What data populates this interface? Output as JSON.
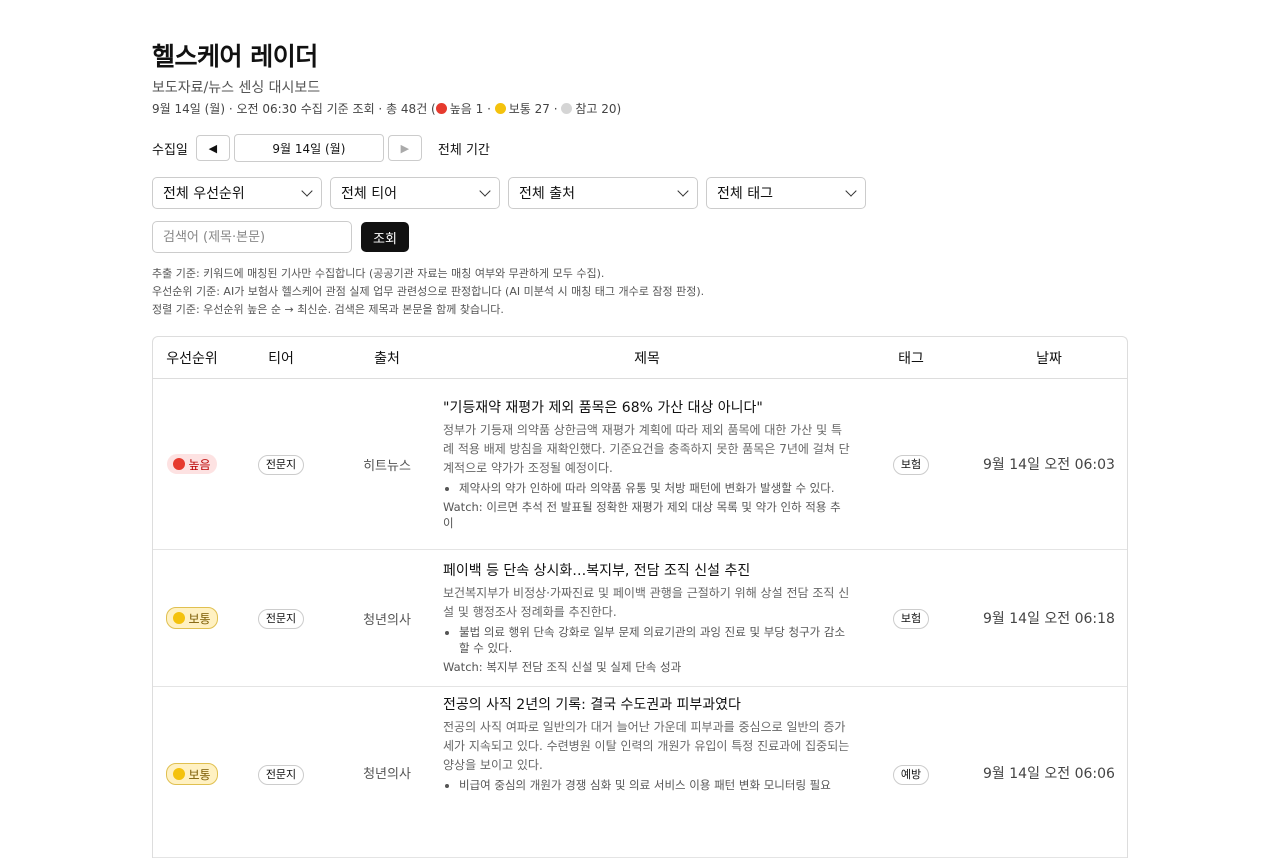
{
  "header": {
    "title": "헬스케어 레이더",
    "subtitle": "보도자료/뉴스 센싱 대시보드",
    "meta_prefix": "9월 14일 (월) · 오전 06:30 수집 기준 조회 · 총 48건 (",
    "meta_high": "높음 1",
    "meta_mid": "보통 27",
    "meta_ref": "참고 20)",
    "sep": " · "
  },
  "datebar": {
    "label": "수집일",
    "prev": "◀",
    "date": "9월 14일 (월)",
    "next": "▶",
    "all_period": "전체 기간"
  },
  "filters": [
    "전체 우선순위",
    "전체 티어",
    "전체 출처",
    "전체 태그"
  ],
  "search": {
    "placeholder": "검색어 (제목·본문)",
    "button": "조회"
  },
  "notes": [
    "추출 기준: 키워드에 매칭된 기사만 수집합니다 (공공기관 자료는 매칭 여부와 무관하게 모두 수집).",
    "우선순위 기준: AI가 보험사 헬스케어 관점 실제 업무 관련성으로 판정합니다 (AI 미분석 시 매칭 태그 개수로 잠정 판정).",
    "정렬 기준: 우선순위 높은 순 → 최신순. 검색은 제목과 본문을 함께 찾습니다."
  ],
  "table": {
    "headers": [
      "우선순위",
      "티어",
      "출처",
      "제목",
      "태그",
      "날짜"
    ],
    "rows": [
      {
        "priority": "높음",
        "priority_color": "#e63a2e",
        "tier": "전문지",
        "source": "히트뉴스",
        "title": "\"기등재약 재평가 제외 품목은 68% 가산 대상 아니다\"",
        "body": "정부가 기등재 의약품 상한금액 재평가 계획에 따라 제외 품목에 대한 가산 및 특례 적용 배제 방침을 재확인했다. 기준요건을 충족하지 못한 품목은 7년에 걸쳐 단계적으로 약가가 조정될 예정이다.",
        "bullet": "제약사의 약가 인하에 따라 의약품 유통 및 처방 패턴에 변화가 발생할 수 있다.",
        "watch": "Watch: 이르면 추석 전 발표될 정확한 재평가 제외 대상 목록 및 약가 인하 적용 추이",
        "tag": "보험",
        "date": "9월 14일 오전 06:03"
      },
      {
        "priority": "보통",
        "priority_color": "#f4c20d",
        "tier": "전문지",
        "source": "청년의사",
        "title": "페이백 등 단속 상시화…복지부, 전담 조직 신설 추진",
        "body": "보건복지부가 비정상·가짜진료 및 페이백 관행을 근절하기 위해 상설 전담 조직 신설 및 행정조사 정례화를 추진한다.",
        "bullet": "불법 의료 행위 단속 강화로 일부 문제 의료기관의 과잉 진료 및 부당 청구가 감소할 수 있다.",
        "watch": "Watch: 복지부 전담 조직 신설 및 실제 단속 성과",
        "tag": "보험",
        "date": "9월 14일 오전 06:18"
      },
      {
        "priority": "보통",
        "priority_color": "#f4c20d",
        "tier": "전문지",
        "source": "청년의사",
        "title": "전공의 사직 2년의 기록: 결국 수도권과 피부과였다",
        "body": "전공의 사직 여파로 일반의가 대거 늘어난 가운데 피부과를 중심으로 일반의 증가세가 지속되고 있다. 수련병원 이탈 인력의 개원가 유입이 특정 진료과에 집중되는 양상을 보이고 있다.",
        "bullet": "비급여 중심의 개원가 경쟁 심화 및 의료 서비스 이용 패턴 변화 모니터링 필요",
        "watch": "",
        "tag": "예방",
        "date": "9월 14일 오전 06:06"
      }
    ]
  }
}
